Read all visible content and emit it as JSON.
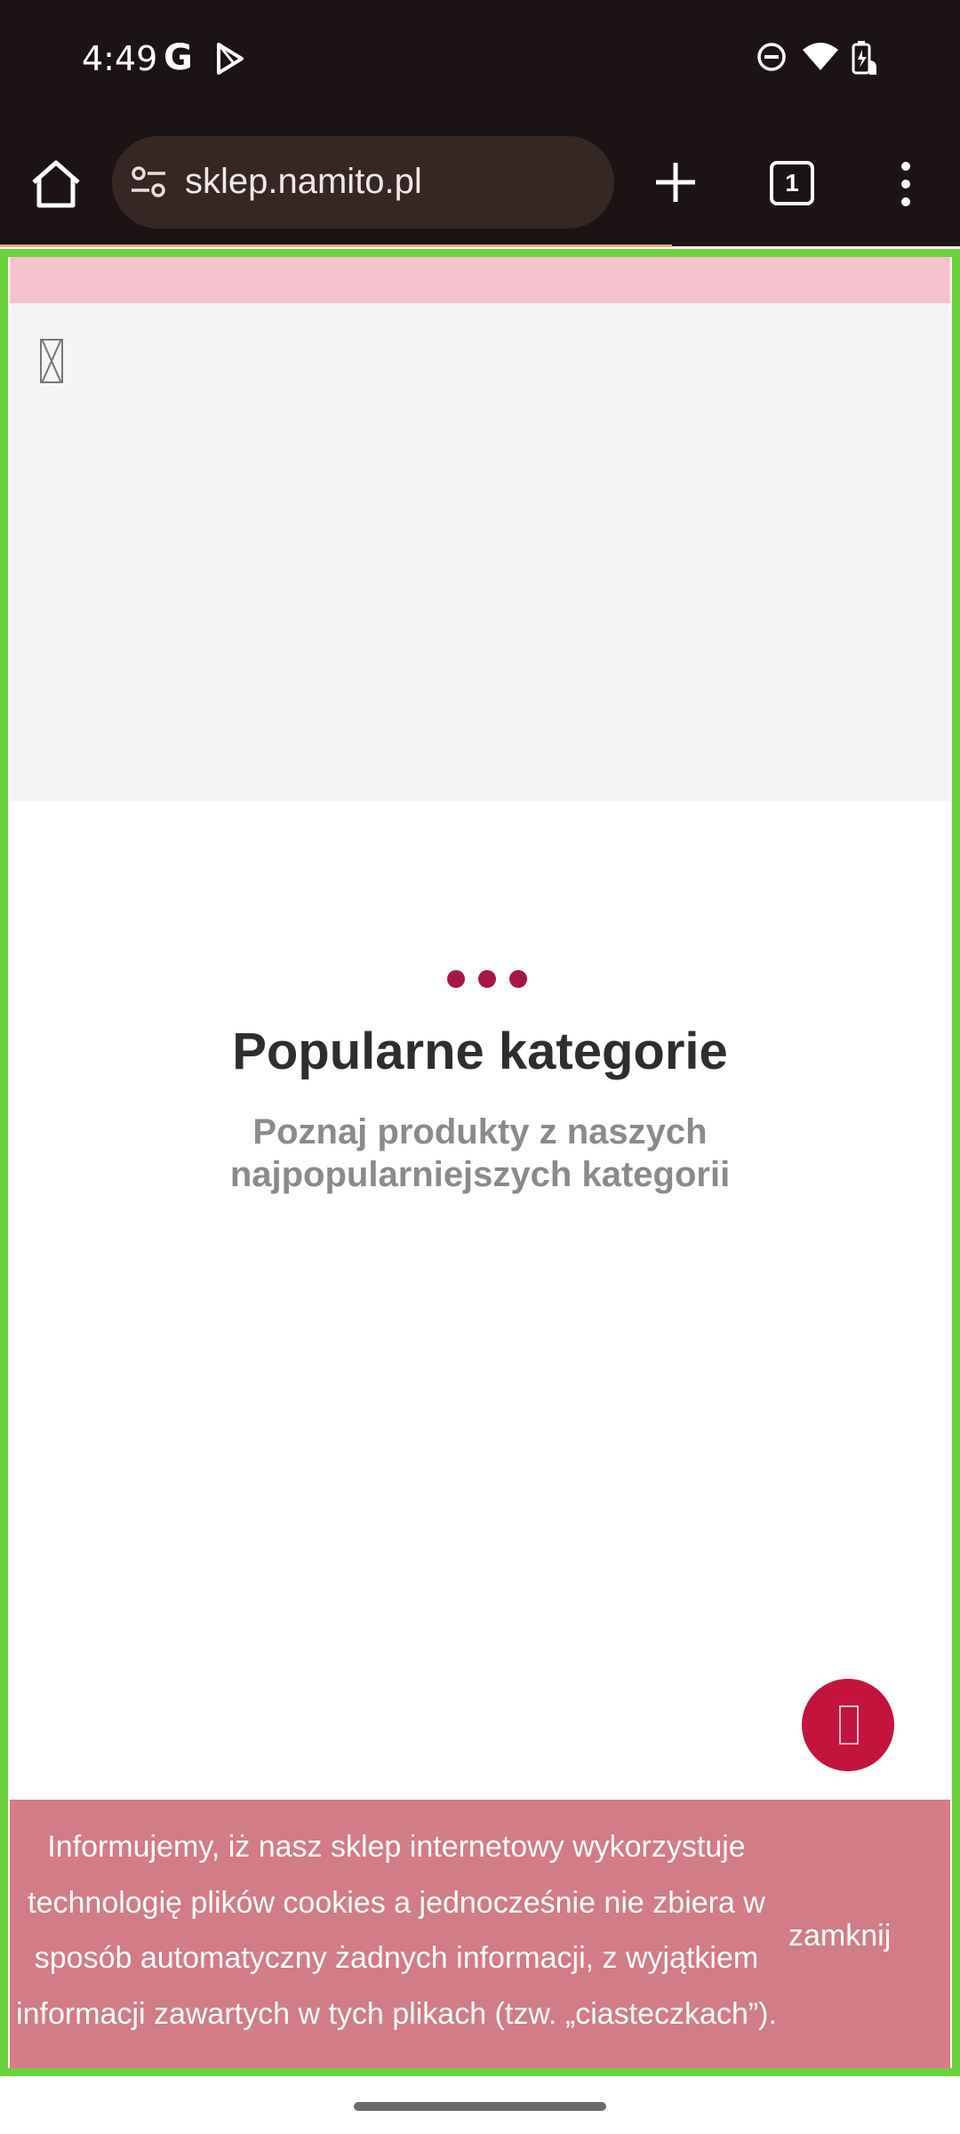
{
  "status_bar": {
    "time": "4:49",
    "left_icons": [
      "google-g-icon",
      "play-store-icon"
    ],
    "right_icons": [
      "do-not-disturb-icon",
      "wifi-icon",
      "battery-charging-icon"
    ],
    "google_glyph": "G"
  },
  "browser": {
    "url": "sklep.namito.pl",
    "tab_count": "1",
    "load_progress": 0.7
  },
  "colors": {
    "frame_highlight": "#6bd23d",
    "accent": "#a81648",
    "cookie_bg": "#d17c86",
    "fab_bg": "#c2143c"
  },
  "section": {
    "title": "Popularne kategorie",
    "subtitle": "Poznaj produkty z naszych najpopularniejszych kategorii"
  },
  "cookie_notice": {
    "text": "Informujemy, iż nasz sklep internetowy wykorzystuje technologię plików cookies a jednocześnie nie zbiera w sposób automatyczny żadnych informacji, z wyjątkiem informacji zawartych w tych plikach (tzw. „ciasteczkach”).",
    "close_label": "zamknij"
  }
}
